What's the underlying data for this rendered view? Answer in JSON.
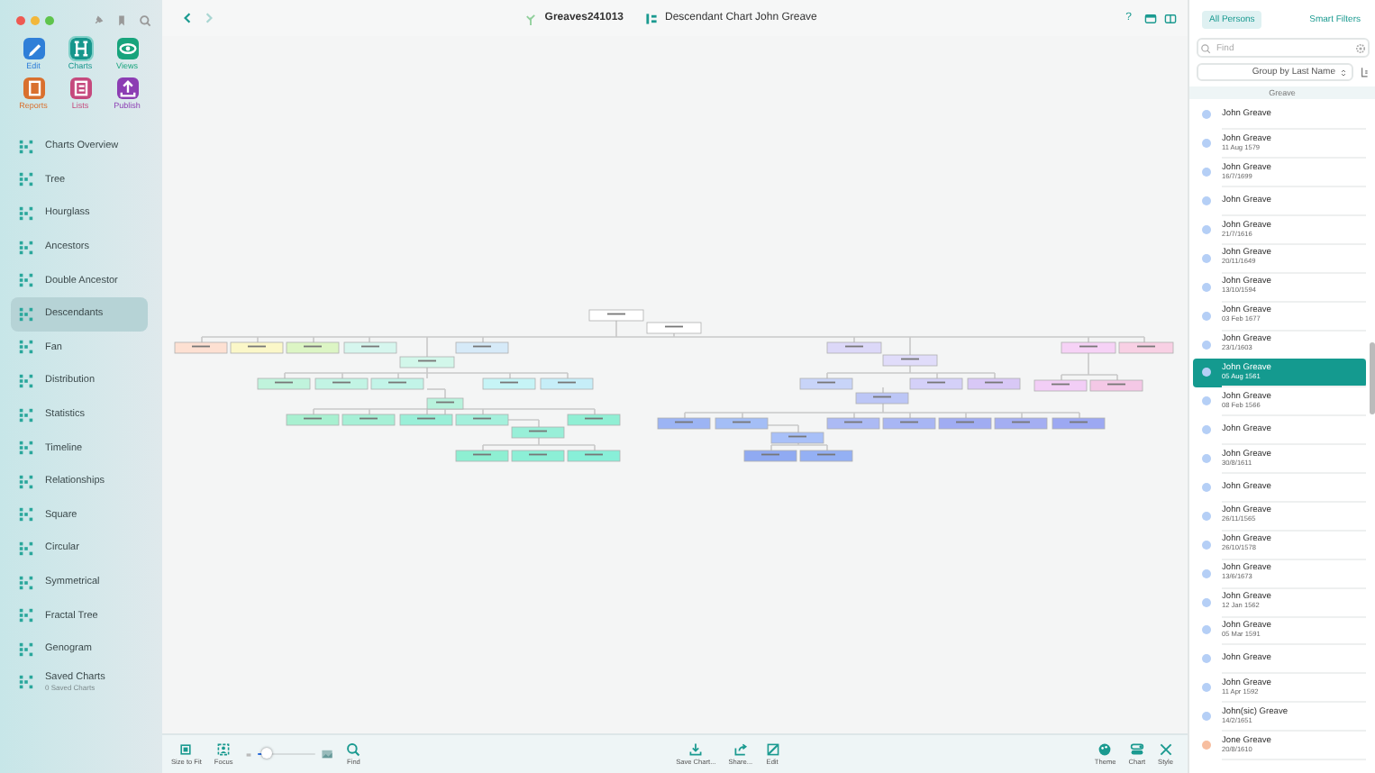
{
  "toolbar_apps": [
    {
      "label": "Edit",
      "color": "#2f7fd8",
      "selected": false
    },
    {
      "label": "Charts",
      "color": "#16968c",
      "selected": true
    },
    {
      "label": "Views",
      "color": "#17a47c",
      "selected": false
    },
    {
      "label": "Reports",
      "color": "#d9702e",
      "selected": false
    },
    {
      "label": "Lists",
      "color": "#c5497d",
      "selected": false
    },
    {
      "label": "Publish",
      "color": "#8c3db3",
      "selected": false
    }
  ],
  "sidebar": {
    "items": [
      {
        "label": "Charts Overview",
        "selected": false
      },
      {
        "label": "Tree",
        "selected": false
      },
      {
        "label": "Hourglass",
        "selected": false
      },
      {
        "label": "Ancestors",
        "selected": false
      },
      {
        "label": "Double Ancestor",
        "selected": false
      },
      {
        "label": "Descendants",
        "selected": true
      },
      {
        "label": "Fan",
        "selected": false
      },
      {
        "label": "Distribution",
        "selected": false
      },
      {
        "label": "Statistics",
        "selected": false
      },
      {
        "label": "Timeline",
        "selected": false
      },
      {
        "label": "Relationships",
        "selected": false
      },
      {
        "label": "Square",
        "selected": false
      },
      {
        "label": "Circular",
        "selected": false
      },
      {
        "label": "Symmetrical",
        "selected": false
      },
      {
        "label": "Fractal Tree",
        "selected": false
      },
      {
        "label": "Genogram",
        "selected": false
      },
      {
        "label": "Saved Charts",
        "subtitle": "0 Saved Charts",
        "selected": false
      }
    ]
  },
  "header": {
    "database": "Greaves241013",
    "chart_title": "Descendant Chart John Greave",
    "help": "?"
  },
  "bottom_toolbar": {
    "left": [
      "Size to Fit",
      "Focus"
    ],
    "zoom": {
      "level": 0.15
    },
    "find": "Find",
    "middle": [
      "Save Chart...",
      "Share...",
      "Edit"
    ],
    "right": [
      "Theme",
      "Chart",
      "Style"
    ]
  },
  "persons_panel": {
    "tabs": [
      {
        "label": "All Persons",
        "selected": true
      },
      {
        "label": "Smart Filters",
        "selected": false
      }
    ],
    "search": {
      "placeholder": "Find"
    },
    "group_by": "Group by Last Name",
    "group_header": "Greave",
    "rows": [
      {
        "name": "John Greave",
        "color": "#b5cff6",
        "selected": false
      },
      {
        "name": "John Greave",
        "date": "11 Aug 1579",
        "color": "#b5cff6",
        "selected": false
      },
      {
        "name": "John Greave",
        "date": "16/7/1699",
        "color": "#b5cff6",
        "selected": false
      },
      {
        "name": "John Greave",
        "color": "#b5cff6",
        "selected": false
      },
      {
        "name": "John Greave",
        "date": "21/7/1616",
        "color": "#b5cff6",
        "selected": false
      },
      {
        "name": "John Greave",
        "date": "20/11/1649",
        "color": "#b5cff6",
        "selected": false
      },
      {
        "name": "John Greave",
        "date": "13/10/1594",
        "color": "#b5cff6",
        "selected": false
      },
      {
        "name": "John Greave",
        "date": "03 Feb 1677",
        "color": "#b5cff6",
        "selected": false
      },
      {
        "name": "John Greave",
        "date": "23/1/1603",
        "color": "#b5cff6",
        "selected": false
      },
      {
        "name": "John Greave",
        "date": "05 Aug 1561",
        "color": "#b5cff6",
        "selected": true
      },
      {
        "name": "John Greave",
        "date": "08 Feb 1566",
        "color": "#b5cff6",
        "selected": false
      },
      {
        "name": "John Greave",
        "color": "#b5cff6",
        "selected": false
      },
      {
        "name": "John Greave",
        "date": "30/8/1611",
        "color": "#b5cff6",
        "selected": false
      },
      {
        "name": "John Greave",
        "color": "#b5cff6",
        "selected": false
      },
      {
        "name": "John Greave",
        "date": "26/11/1565",
        "color": "#b5cff6",
        "selected": false
      },
      {
        "name": "John Greave",
        "date": "26/10/1578",
        "color": "#b5cff6",
        "selected": false
      },
      {
        "name": "John Greave",
        "date": "13/6/1673",
        "color": "#b5cff6",
        "selected": false
      },
      {
        "name": "John Greave",
        "date": "12 Jan 1562",
        "color": "#b5cff6",
        "selected": false
      },
      {
        "name": "John Greave",
        "date": "05 Mar 1591",
        "color": "#b5cff6",
        "selected": false
      },
      {
        "name": "John Greave",
        "color": "#b5cff6",
        "selected": false
      },
      {
        "name": "John Greave",
        "date": "11 Apr 1592",
        "color": "#b5cff6",
        "selected": false
      },
      {
        "name": "John(sic) Greave",
        "date": "14/2/1651",
        "color": "#b5cff6",
        "selected": false
      },
      {
        "name": "Jone Greave",
        "date": "20/8/1610",
        "color": "#f7bea0",
        "selected": false
      }
    ]
  }
}
